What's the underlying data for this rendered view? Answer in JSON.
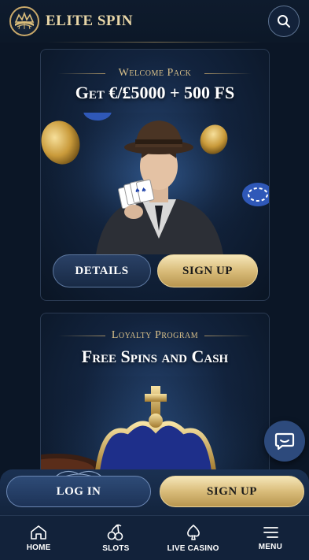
{
  "header": {
    "brand": "ELITE SPIN",
    "search_icon": "search-icon",
    "logo_icon": "crown-roulette-logo-icon"
  },
  "promos": [
    {
      "kicker": "Welcome Pack",
      "headline": "Get €/£5000 + 500 FS",
      "details_label": "DETAILS",
      "signup_label": "SIGN UP"
    },
    {
      "kicker": "Loyalty Program",
      "headline": "Free Spins and Cash"
    }
  ],
  "auth": {
    "login_label": "LOG IN",
    "signup_label": "SIGN UP"
  },
  "nav": [
    {
      "label": "HOME",
      "icon": "home-icon"
    },
    {
      "label": "SLOTS",
      "icon": "cherries-icon"
    },
    {
      "label": "LIVE CASINO",
      "icon": "spade-icon"
    },
    {
      "label": "MENU",
      "icon": "menu-icon"
    }
  ],
  "colors": {
    "background": "#0b1626",
    "gold": "#d9bc7a",
    "navy_button": "#1d3357",
    "nav_bar": "#12223a"
  }
}
